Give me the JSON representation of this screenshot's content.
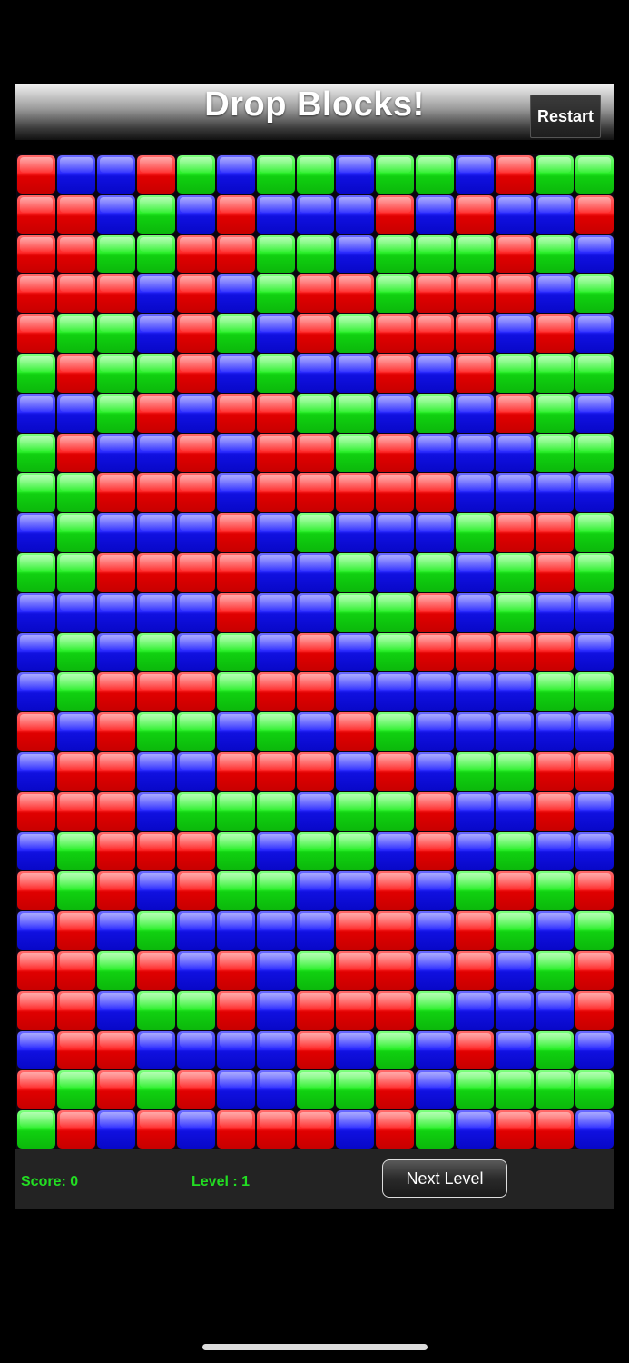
{
  "header": {
    "title": "Drop Blocks!",
    "restart_label": "Restart"
  },
  "footer": {
    "score_text": "Score: 0",
    "level_text": "Level : 1",
    "next_level_label": "Next Level"
  },
  "colors": {
    "red": "#ff2a2a",
    "green": "#2cf02c",
    "blue": "#2c2cff",
    "score_text": "#22dd22"
  },
  "board": {
    "columns": 15,
    "rows": 25,
    "grid": [
      "RBBRGBGGBGGBRGG",
      "RRBGBRBBBRBRBBR",
      "RRGGRRGGBGGGRGB",
      "RRRBRBGRRGRRRBG",
      "RGGBRGBRGRRRBRB",
      "GRGGRBGBBRBRGGG",
      "BBGRBRRGGBGBRGB",
      "GRBBRBRRGRBBBGG",
      "GGRRRBRRRRRBBBB",
      "BGBBBRBGBBBGRRG",
      "GGRRRRBBGBGBGRG",
      "BBBBBRBBGGRBGBB",
      "BGBGBGBRBGRRRRB",
      "BGRRRGRRBBBBBGG",
      "RBRGGBGBRGBBBBB",
      "BRRBBRRRBRBGGRR",
      "RRRBGGGBGGRBBRB",
      "BGRRRGBGGBRBGBB",
      "RGRBRGGBBRBGRGR",
      "BRBGBBBBRRBRGBG",
      "RRGRBRBGRRBRBGR",
      "RRBGGRBRRRGBBBR",
      "BRRBBBBRBGBRBGB",
      "RGRGRBBGGRBGGGG",
      "GRBRBRRRBRGBRRB"
    ]
  }
}
